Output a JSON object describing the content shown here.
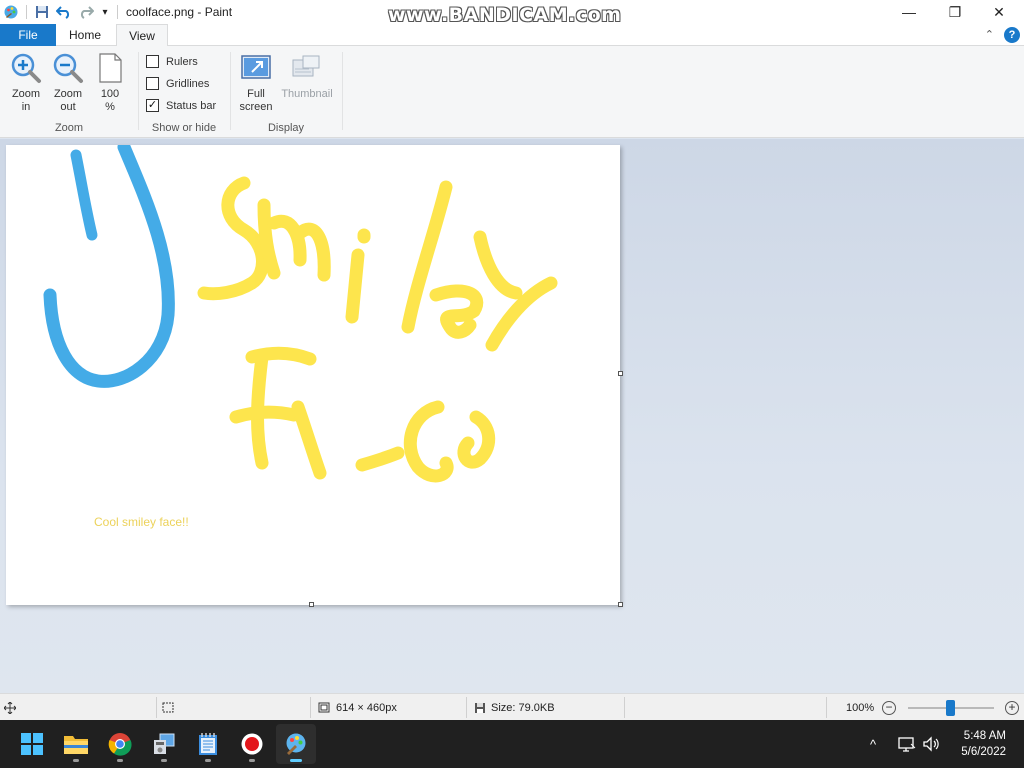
{
  "window": {
    "title": "coolface.png - Paint",
    "overlay_watermark": "www.BANDICAM.com",
    "controls": {
      "minimize": "—",
      "restore": "❐",
      "close": "✕"
    }
  },
  "ribbon_tabs": {
    "file": "File",
    "home": "Home",
    "view": "View",
    "collapse": "⌃",
    "help": "?"
  },
  "ribbon": {
    "zoom_group": {
      "label": "Zoom",
      "zoom_in": [
        "Zoom",
        "in"
      ],
      "zoom_out": [
        "Zoom",
        "out"
      ],
      "hundred": [
        "100",
        "%"
      ]
    },
    "show_hide_group": {
      "label": "Show or hide",
      "rulers": {
        "label": "Rulers",
        "checked": false
      },
      "gridlines": {
        "label": "Gridlines",
        "checked": false
      },
      "status_bar": {
        "label": "Status bar",
        "checked": true
      }
    },
    "display_group": {
      "label": "Display",
      "full_screen": [
        "Full",
        "screen"
      ],
      "thumbnail": "Thumbnail"
    }
  },
  "canvas": {
    "caption_text": "Cool smiley face!!",
    "stroke_colors": {
      "blue": "#3aa7e6",
      "yellow": "#fde33a"
    }
  },
  "statusbar": {
    "dimensions": "614 × 460px",
    "size": "Size: 79.0KB",
    "zoom_level": "100%",
    "zoom_out": "−",
    "zoom_in": "+"
  },
  "taskbar": {
    "apps": [
      "start-icon",
      "file-explorer-icon",
      "chrome-icon",
      "control-panel-icon",
      "notepad-icon",
      "record-icon",
      "paint-icon"
    ],
    "tray_chevron": "^",
    "time": "5:48 AM",
    "date": "5/6/2022"
  },
  "colors": {
    "accent": "#1979ca",
    "taskbar": "#202020",
    "active_indicator": "#60cdff"
  }
}
